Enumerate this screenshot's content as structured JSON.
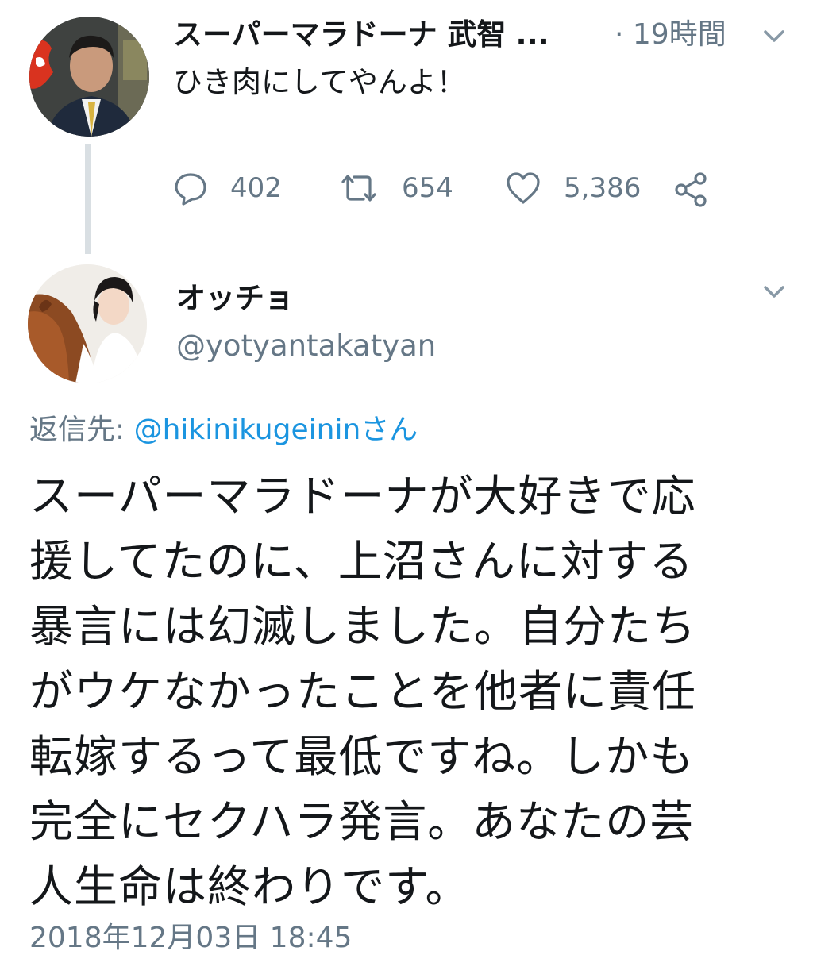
{
  "tweet1": {
    "display_name": "スーパーマラドーナ 武智",
    "name_ellipsis": "...",
    "time": "· 19時間",
    "text": "ひき肉にしてやんよ！",
    "stats": {
      "replies": "402",
      "retweets": "654",
      "likes": "5,386"
    }
  },
  "tweet2": {
    "display_name": "オッチョ",
    "handle": "@yotyantakatyan",
    "reply_prefix": "返信先: ",
    "reply_to": "@hikinikugeinin",
    "reply_suffix": "さん",
    "body_lines": [
      "スーパーマラドーナが大好きで応",
      "援してたのに、上沼さんに対する",
      "暴言には幻滅しました。自分たち",
      "がウケなかったことを他者に責任",
      "転嫁するって最低ですね。しかも",
      "完全にセクハラ発言。あなたの芸",
      "人生命は終わりです。"
    ],
    "date": "2018年12月03日 18:45"
  },
  "colors": {
    "text_primary": "#14171a",
    "text_secondary": "#657786",
    "link": "#1b95e0",
    "thread_line": "#d9dfe3"
  },
  "icons": {
    "reply": "reply-icon",
    "retweet": "retweet-icon",
    "like": "heart-icon",
    "share": "share-icon",
    "menu": "chevron-down-icon"
  }
}
